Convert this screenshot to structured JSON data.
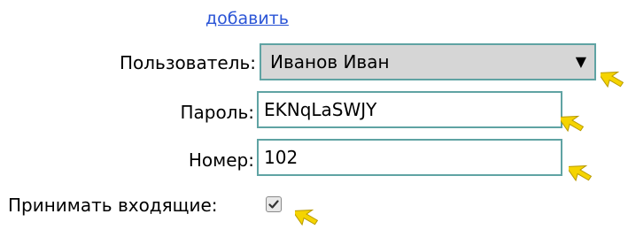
{
  "form": {
    "add_link": "добавить",
    "user_label": "Пользователь:",
    "user_value": "Иванов Иван",
    "password_label": "Пароль:",
    "password_value": "EKNqLaSWJY",
    "number_label": "Номер:",
    "number_value": "102",
    "incoming_label": "Принимать входящие:",
    "incoming_checked": true
  },
  "icons": {
    "select_arrow": "dropdown-arrow-icon",
    "cursor": "pointer-cursor-icon",
    "check": "checkmark-icon"
  },
  "colors": {
    "link": "#2a54d6",
    "field_border": "#5fa3a3",
    "select_bg": "#d6d6d6",
    "cursor_fill": "#f5d400"
  }
}
